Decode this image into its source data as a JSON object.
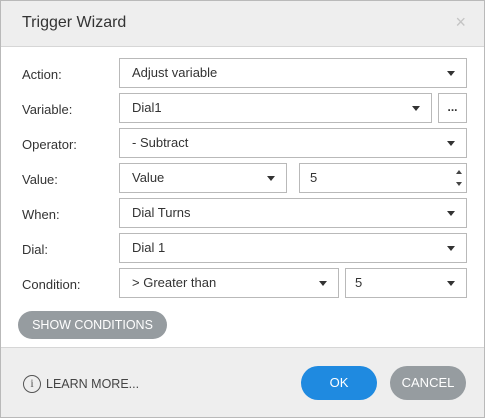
{
  "dialog": {
    "title": "Trigger Wizard",
    "close_glyph": "×"
  },
  "form": {
    "action": {
      "label": "Action:",
      "value": "Adjust variable"
    },
    "variable": {
      "label": "Variable:",
      "value": "Dial1",
      "more_label": "..."
    },
    "operator": {
      "label": "Operator:",
      "value": "- Subtract"
    },
    "value": {
      "label": "Value:",
      "type_value": "Value",
      "number": "5"
    },
    "when": {
      "label": "When:",
      "value": "Dial Turns"
    },
    "dial": {
      "label": "Dial:",
      "value": "Dial 1"
    },
    "condition": {
      "label": "Condition:",
      "comparator": "> Greater than",
      "value": "5"
    }
  },
  "buttons": {
    "show_conditions": "SHOW CONDITIONS",
    "learn_more": "LEARN MORE...",
    "info_glyph": "i",
    "ok": "OK",
    "cancel": "CANCEL"
  },
  "icons": {
    "close": "close-icon",
    "dropdown": "chevron-down-icon",
    "info": "info-icon"
  },
  "colors": {
    "primary": "#1f8ae0",
    "secondary": "#969ca0",
    "header_bg": "#eeeeee"
  }
}
